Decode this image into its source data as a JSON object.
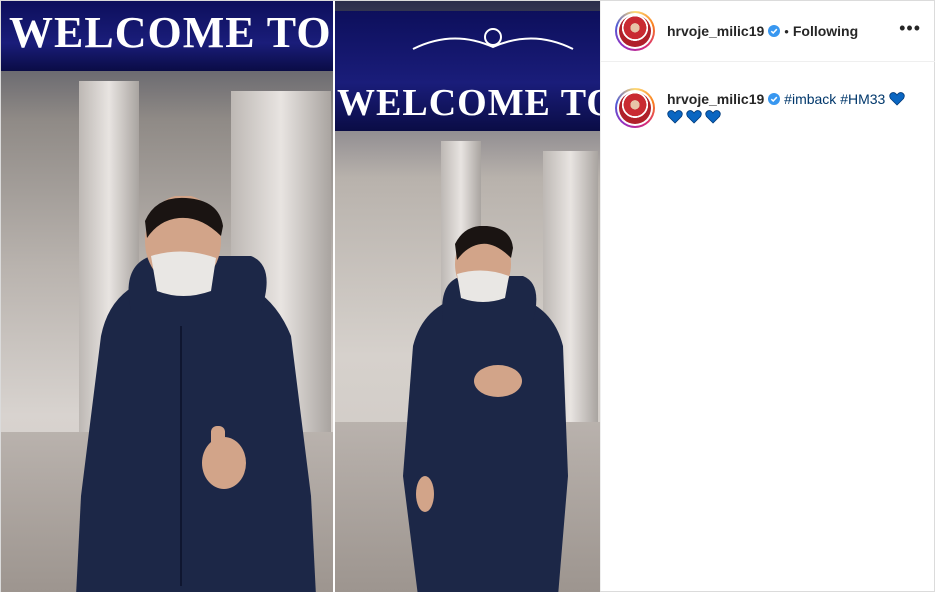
{
  "post": {
    "username": "hrvoje_milic19",
    "separator": "•",
    "follow_status": "Following",
    "more_icon": "more-horizontal-icon",
    "banner_text": "WELCOME TO",
    "caption": {
      "username": "hrvoje_milic19",
      "hashtags": [
        "#imback",
        "#HM33"
      ],
      "hearts": 4,
      "heart_color": "#0a66c2"
    },
    "verified_color": "#3897f0"
  }
}
